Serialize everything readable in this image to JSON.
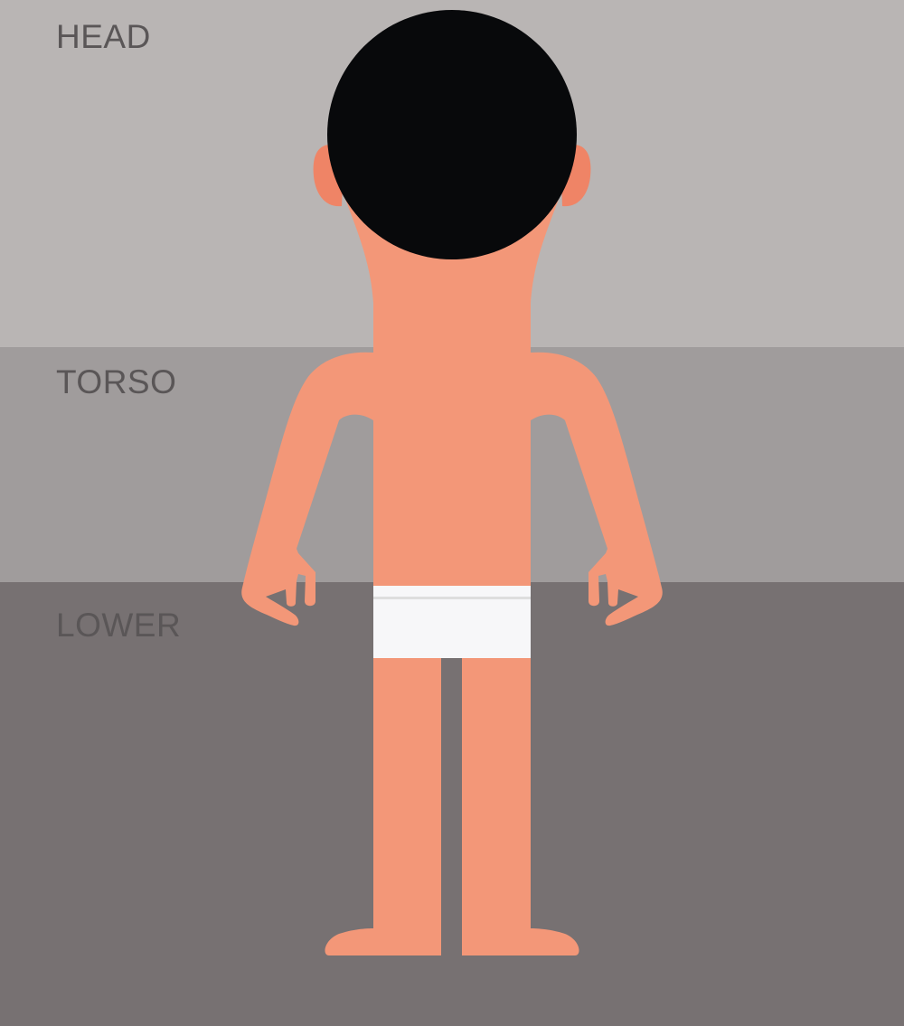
{
  "regions": {
    "head": {
      "label": "HEAD",
      "color": "#b9b5b4"
    },
    "torso": {
      "label": "TORSO",
      "color": "#a09c9c"
    },
    "lower": {
      "label": "LOWER",
      "color": "#777172"
    }
  },
  "figure": {
    "skin_color": "#f39778",
    "ear_color": "#ef8466",
    "hair_color": "#08090b",
    "underwear_color": "#f7f7f9",
    "underwear_line_color": "#dedede"
  }
}
